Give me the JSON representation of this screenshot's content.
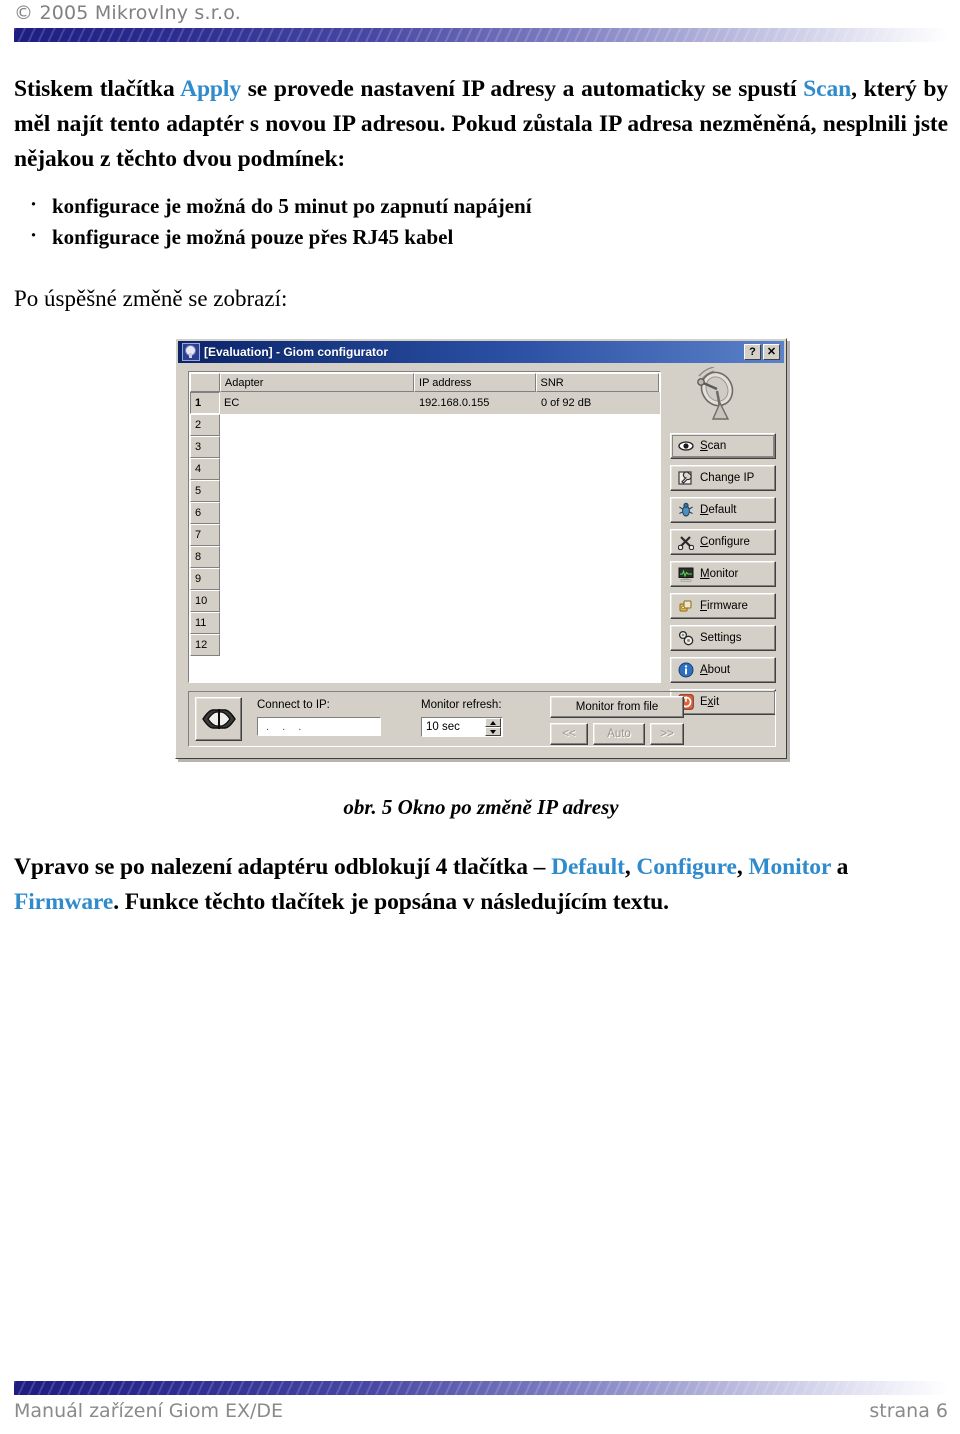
{
  "header": {
    "copyright": "© 2005 Mikrovlny s.r.o."
  },
  "body_text": {
    "para1_part1": "Stiskem tlačítka ",
    "para1_link1": "Apply",
    "para1_part2": " se provede nastavení IP adresy a automaticky se spustí  ",
    "para1_link2": "Scan",
    "para1_part3": ", který by měl najít tento adaptér s novou IP adresou. Pokud zůstala IP adresa nezměněná, nesplnili jste nějakou z těchto dvou podmínek:",
    "bullets": [
      "konfigurace je možná do 5 minut po zapnutí napájení",
      "konfigurace je možná pouze přes RJ45 kabel"
    ],
    "lead_in": "Po úspěšné  změně se  zobrazí:",
    "caption": "obr. 5  Okno po změně IP adresy",
    "closing_part1": "Vpravo se po nalezení adaptéru odblokují 4 tlačítka – ",
    "closing_link1": "Default",
    "closing_sep1": ", ",
    "closing_link2": "Configure",
    "closing_sep2": ", ",
    "closing_link3": "Monitor",
    "closing_sep3": " a ",
    "closing_link4": "Firmware",
    "closing_part2": ". Funkce těchto tlačítek je popsána v následujícím textu."
  },
  "app_window": {
    "title": "[Evaluation] - Giom configurator",
    "title_buttons": {
      "help": "?",
      "close": "✕"
    },
    "table": {
      "columns": [
        "",
        "Adapter",
        "IP address",
        "SNR"
      ],
      "rows": [
        {
          "num": "1",
          "adapter": "EC",
          "ip": "192.168.0.155",
          "snr": "0 of 92 dB"
        }
      ],
      "row_numbers": [
        "1",
        "2",
        "3",
        "4",
        "5",
        "6",
        "7",
        "8",
        "9",
        "10",
        "11",
        "12"
      ]
    },
    "buttons": [
      {
        "label": "Scan",
        "accel": "S",
        "icon": "eye-icon"
      },
      {
        "label": "Change IP",
        "accel": "",
        "icon": "wrench-icon"
      },
      {
        "label": "Default",
        "accel": "D",
        "icon": "bug-icon"
      },
      {
        "label": "Configure",
        "accel": "C",
        "icon": "tools-icon"
      },
      {
        "label": "Monitor",
        "accel": "M",
        "icon": "monitor-icon"
      },
      {
        "label": "Firmware",
        "accel": "F",
        "icon": "chip-icon"
      },
      {
        "label": "Settings",
        "accel": "",
        "icon": "gears-icon"
      },
      {
        "label": "About",
        "accel": "A",
        "icon": "info-icon"
      },
      {
        "label": "Exit",
        "accel": "x",
        "icon": "power-icon"
      }
    ],
    "bottom_panel": {
      "connect_label": "Connect to IP:",
      "connect_value": ".  .  .",
      "refresh_label": "Monitor refresh:",
      "refresh_value": "10 sec",
      "monitor_from_file": "Monitor from file",
      "nav_prev": "<<",
      "nav_auto": "Auto",
      "nav_next": ">>"
    }
  },
  "footer": {
    "left": "Manuál zařízení Giom EX/DE",
    "right": "strana 6"
  },
  "colors": {
    "link_blue": "#2f8bcb",
    "band_navy": "#1d1d82",
    "titlebar_navy": "#0a246a",
    "window_face": "#d4d0c8",
    "muted_gray": "#8a8a8a"
  }
}
